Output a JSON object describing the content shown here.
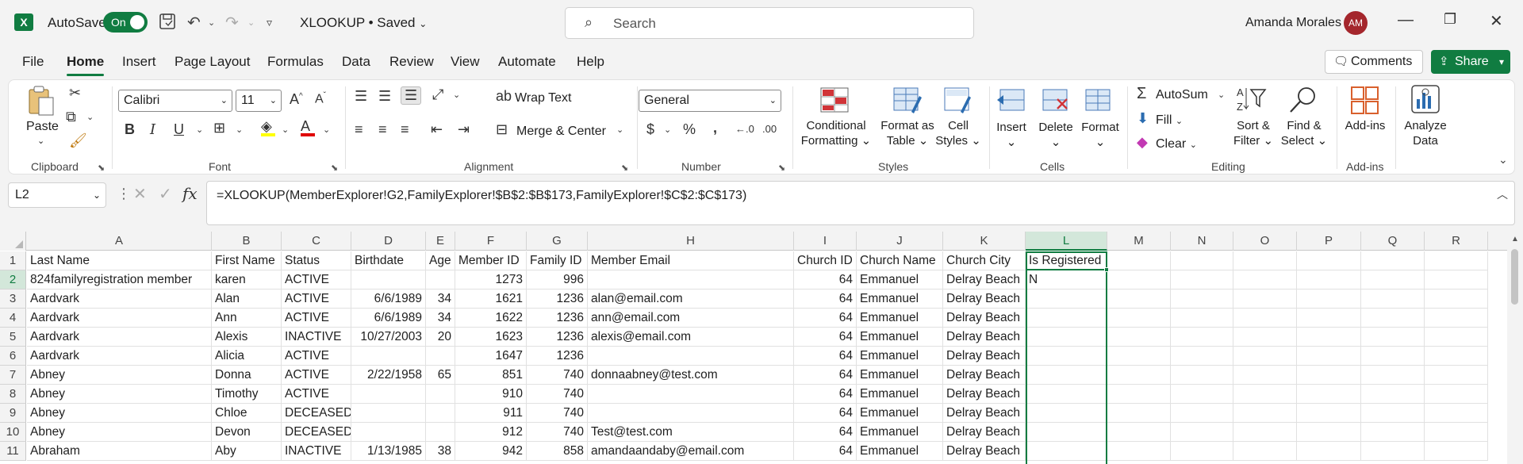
{
  "titlebar": {
    "autosave_label": "AutoSave",
    "autosave_state": "On",
    "doc_title": "XLOOKUP • Saved",
    "search_placeholder": "Search",
    "user_name": "Amanda Morales",
    "user_initials": "AM",
    "app_icon_letter": "X"
  },
  "menu": {
    "tabs": [
      "File",
      "Home",
      "Insert",
      "Page Layout",
      "Formulas",
      "Data",
      "Review",
      "View",
      "Automate",
      "Help"
    ],
    "active_tab": "Home",
    "comments_label": "Comments",
    "share_label": "Share"
  },
  "ribbon": {
    "clipboard": {
      "paste": "Paste",
      "label": "Clipboard"
    },
    "font": {
      "name": "Calibri",
      "size": "11",
      "label": "Font",
      "bold": "B",
      "italic": "I",
      "underline": "U"
    },
    "alignment": {
      "wrap_text": "Wrap Text",
      "merge_center": "Merge & Center",
      "label": "Alignment"
    },
    "number": {
      "format": "General",
      "label": "Number",
      "currency": "$",
      "percent": "%"
    },
    "styles": {
      "conditional_1": "Conditional",
      "conditional_2": "Formatting",
      "format_table_1": "Format as",
      "format_table_2": "Table",
      "cell_styles_1": "Cell",
      "cell_styles_2": "Styles",
      "label": "Styles"
    },
    "cells": {
      "insert": "Insert",
      "delete": "Delete",
      "format": "Format",
      "label": "Cells"
    },
    "editing": {
      "autosum": "AutoSum",
      "fill": "Fill",
      "clear": "Clear",
      "sort_1": "Sort &",
      "sort_2": "Filter",
      "find_1": "Find &",
      "find_2": "Select",
      "label": "Editing"
    },
    "addins": {
      "addins": "Add-ins",
      "label": "Add-ins"
    },
    "analyze": {
      "line1": "Analyze",
      "line2": "Data"
    }
  },
  "formula_bar": {
    "name_box": "L2",
    "fx": "fx",
    "formula": "=XLOOKUP(MemberExplorer!G2,FamilyExplorer!$B$2:$B$173,FamilyExplorer!$C$2:$C$173)"
  },
  "sheet": {
    "columns": [
      "A",
      "B",
      "C",
      "D",
      "E",
      "F",
      "G",
      "H",
      "I",
      "J",
      "K",
      "L",
      "M",
      "N",
      "O",
      "P",
      "Q",
      "R"
    ],
    "active_column": "L",
    "active_row": "2",
    "row_numbers": [
      "1",
      "2",
      "3",
      "4",
      "5",
      "6",
      "7",
      "8",
      "9",
      "10",
      "11"
    ],
    "rows": [
      [
        "Last Name",
        "First Name",
        "Status",
        "Birthdate",
        "Age",
        "Member ID",
        "Family ID",
        "Member Email",
        "Church ID",
        "Church Name",
        "Church City",
        "Is Registered"
      ],
      [
        "824familyregistration member",
        "karen",
        "ACTIVE",
        "",
        "",
        "1273",
        "996",
        "",
        "64",
        "Emmanuel",
        "Delray Beach",
        "N"
      ],
      [
        "Aardvark",
        "Alan",
        "ACTIVE",
        "6/6/1989",
        "34",
        "1621",
        "1236",
        "alan@email.com",
        "64",
        "Emmanuel",
        "Delray Beach",
        ""
      ],
      [
        "Aardvark",
        "Ann",
        "ACTIVE",
        "6/6/1989",
        "34",
        "1622",
        "1236",
        "ann@email.com",
        "64",
        "Emmanuel",
        "Delray Beach",
        ""
      ],
      [
        "Aardvark",
        "Alexis",
        "INACTIVE",
        "10/27/2003",
        "20",
        "1623",
        "1236",
        "alexis@email.com",
        "64",
        "Emmanuel",
        "Delray Beach",
        ""
      ],
      [
        "Aardvark",
        "Alicia",
        "ACTIVE",
        "",
        "",
        "1647",
        "1236",
        "",
        "64",
        "Emmanuel",
        "Delray Beach",
        ""
      ],
      [
        "Abney",
        "Donna",
        "ACTIVE",
        "2/22/1958",
        "65",
        "851",
        "740",
        "donnaabney@test.com",
        "64",
        "Emmanuel",
        "Delray Beach",
        ""
      ],
      [
        "Abney",
        "Timothy",
        "ACTIVE",
        "",
        "",
        "910",
        "740",
        "",
        "64",
        "Emmanuel",
        "Delray Beach",
        ""
      ],
      [
        "Abney",
        "Chloe",
        "DECEASED",
        "",
        "",
        "911",
        "740",
        "",
        "64",
        "Emmanuel",
        "Delray Beach",
        ""
      ],
      [
        "Abney",
        "Devon",
        "DECEASED",
        "",
        "",
        "912",
        "740",
        "Test@test.com",
        "64",
        "Emmanuel",
        "Delray Beach",
        ""
      ],
      [
        "Abraham",
        "Aby",
        "INACTIVE",
        "1/13/1985",
        "38",
        "942",
        "858",
        "amandaandaby@email.com",
        "64",
        "Emmanuel",
        "Delray Beach",
        ""
      ]
    ]
  },
  "colors": {
    "accent": "#107c41",
    "avatar": "#a4262c"
  }
}
